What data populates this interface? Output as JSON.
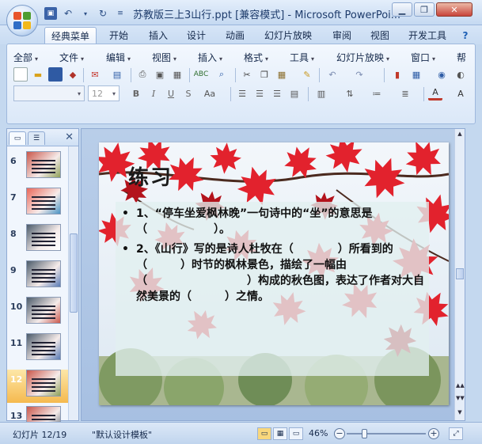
{
  "window": {
    "title": "苏教版三上3山行.ppt [兼容模式] - Microsoft PowerPoi...",
    "minimize_icon": "minimize-icon",
    "maximize_icon": "restore-icon",
    "close_icon": "close-icon"
  },
  "ribbon_tabs": [
    {
      "label": "经典菜单",
      "active": true
    },
    {
      "label": "开始"
    },
    {
      "label": "插入"
    },
    {
      "label": "设计"
    },
    {
      "label": "动画"
    },
    {
      "label": "幻灯片放映"
    },
    {
      "label": "审阅"
    },
    {
      "label": "视图"
    },
    {
      "label": "开发工具"
    }
  ],
  "menus": [
    "全部",
    "文件",
    "编辑",
    "视图",
    "插入",
    "格式",
    "工具",
    "幻灯片放映",
    "窗口",
    "帮"
  ],
  "font_size": {
    "value": "12"
  },
  "format_buttons": [
    "B",
    "I",
    "U",
    "S",
    "Aa"
  ],
  "slide_panel": {
    "tabs": [
      "slides-tab-icon",
      "outline-tab-icon"
    ],
    "thumbnails": [
      {
        "number": "6"
      },
      {
        "number": "7"
      },
      {
        "number": "8"
      },
      {
        "number": "9"
      },
      {
        "number": "10"
      },
      {
        "number": "11"
      },
      {
        "number": "12",
        "selected": true
      },
      {
        "number": "13"
      }
    ]
  },
  "slide": {
    "title": "练习",
    "bullets": [
      "1、“停车坐爱枫林晚”一句诗中的“坐”的意思是（　　　　　　）。",
      "2、《山行》写的是诗人杜牧在（　　　　）所看到的（　　　）时节的枫林景色，描绘了一幅由（　　　　　　　　　）构成的秋色图，表达了作者对大自然美景的（　　　）之情。"
    ]
  },
  "status": {
    "slide_indicator": "幻灯片 12/19",
    "theme": "\"默认设计模板\"",
    "zoom": "46%",
    "zoom_level": 0.46
  },
  "colors": {
    "accent": "#2b579a",
    "leaf_red": "#e0202a",
    "selected_thumb": "#f5b94e"
  }
}
